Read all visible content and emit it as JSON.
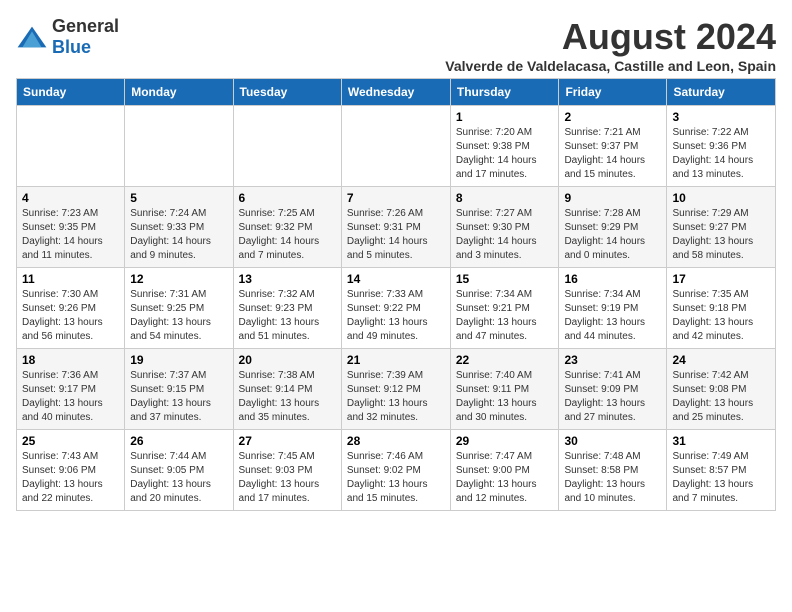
{
  "logo": {
    "general": "General",
    "blue": "Blue"
  },
  "header": {
    "title": "August 2024",
    "subtitle": "Valverde de Valdelacasa, Castille and Leon, Spain"
  },
  "weekdays": [
    "Sunday",
    "Monday",
    "Tuesday",
    "Wednesday",
    "Thursday",
    "Friday",
    "Saturday"
  ],
  "weeks": [
    [
      {
        "day": "",
        "info": ""
      },
      {
        "day": "",
        "info": ""
      },
      {
        "day": "",
        "info": ""
      },
      {
        "day": "",
        "info": ""
      },
      {
        "day": "1",
        "info": "Sunrise: 7:20 AM\nSunset: 9:38 PM\nDaylight: 14 hours and 17 minutes."
      },
      {
        "day": "2",
        "info": "Sunrise: 7:21 AM\nSunset: 9:37 PM\nDaylight: 14 hours and 15 minutes."
      },
      {
        "day": "3",
        "info": "Sunrise: 7:22 AM\nSunset: 9:36 PM\nDaylight: 14 hours and 13 minutes."
      }
    ],
    [
      {
        "day": "4",
        "info": "Sunrise: 7:23 AM\nSunset: 9:35 PM\nDaylight: 14 hours and 11 minutes."
      },
      {
        "day": "5",
        "info": "Sunrise: 7:24 AM\nSunset: 9:33 PM\nDaylight: 14 hours and 9 minutes."
      },
      {
        "day": "6",
        "info": "Sunrise: 7:25 AM\nSunset: 9:32 PM\nDaylight: 14 hours and 7 minutes."
      },
      {
        "day": "7",
        "info": "Sunrise: 7:26 AM\nSunset: 9:31 PM\nDaylight: 14 hours and 5 minutes."
      },
      {
        "day": "8",
        "info": "Sunrise: 7:27 AM\nSunset: 9:30 PM\nDaylight: 14 hours and 3 minutes."
      },
      {
        "day": "9",
        "info": "Sunrise: 7:28 AM\nSunset: 9:29 PM\nDaylight: 14 hours and 0 minutes."
      },
      {
        "day": "10",
        "info": "Sunrise: 7:29 AM\nSunset: 9:27 PM\nDaylight: 13 hours and 58 minutes."
      }
    ],
    [
      {
        "day": "11",
        "info": "Sunrise: 7:30 AM\nSunset: 9:26 PM\nDaylight: 13 hours and 56 minutes."
      },
      {
        "day": "12",
        "info": "Sunrise: 7:31 AM\nSunset: 9:25 PM\nDaylight: 13 hours and 54 minutes."
      },
      {
        "day": "13",
        "info": "Sunrise: 7:32 AM\nSunset: 9:23 PM\nDaylight: 13 hours and 51 minutes."
      },
      {
        "day": "14",
        "info": "Sunrise: 7:33 AM\nSunset: 9:22 PM\nDaylight: 13 hours and 49 minutes."
      },
      {
        "day": "15",
        "info": "Sunrise: 7:34 AM\nSunset: 9:21 PM\nDaylight: 13 hours and 47 minutes."
      },
      {
        "day": "16",
        "info": "Sunrise: 7:34 AM\nSunset: 9:19 PM\nDaylight: 13 hours and 44 minutes."
      },
      {
        "day": "17",
        "info": "Sunrise: 7:35 AM\nSunset: 9:18 PM\nDaylight: 13 hours and 42 minutes."
      }
    ],
    [
      {
        "day": "18",
        "info": "Sunrise: 7:36 AM\nSunset: 9:17 PM\nDaylight: 13 hours and 40 minutes."
      },
      {
        "day": "19",
        "info": "Sunrise: 7:37 AM\nSunset: 9:15 PM\nDaylight: 13 hours and 37 minutes."
      },
      {
        "day": "20",
        "info": "Sunrise: 7:38 AM\nSunset: 9:14 PM\nDaylight: 13 hours and 35 minutes."
      },
      {
        "day": "21",
        "info": "Sunrise: 7:39 AM\nSunset: 9:12 PM\nDaylight: 13 hours and 32 minutes."
      },
      {
        "day": "22",
        "info": "Sunrise: 7:40 AM\nSunset: 9:11 PM\nDaylight: 13 hours and 30 minutes."
      },
      {
        "day": "23",
        "info": "Sunrise: 7:41 AM\nSunset: 9:09 PM\nDaylight: 13 hours and 27 minutes."
      },
      {
        "day": "24",
        "info": "Sunrise: 7:42 AM\nSunset: 9:08 PM\nDaylight: 13 hours and 25 minutes."
      }
    ],
    [
      {
        "day": "25",
        "info": "Sunrise: 7:43 AM\nSunset: 9:06 PM\nDaylight: 13 hours and 22 minutes."
      },
      {
        "day": "26",
        "info": "Sunrise: 7:44 AM\nSunset: 9:05 PM\nDaylight: 13 hours and 20 minutes."
      },
      {
        "day": "27",
        "info": "Sunrise: 7:45 AM\nSunset: 9:03 PM\nDaylight: 13 hours and 17 minutes."
      },
      {
        "day": "28",
        "info": "Sunrise: 7:46 AM\nSunset: 9:02 PM\nDaylight: 13 hours and 15 minutes."
      },
      {
        "day": "29",
        "info": "Sunrise: 7:47 AM\nSunset: 9:00 PM\nDaylight: 13 hours and 12 minutes."
      },
      {
        "day": "30",
        "info": "Sunrise: 7:48 AM\nSunset: 8:58 PM\nDaylight: 13 hours and 10 minutes."
      },
      {
        "day": "31",
        "info": "Sunrise: 7:49 AM\nSunset: 8:57 PM\nDaylight: 13 hours and 7 minutes."
      }
    ]
  ]
}
